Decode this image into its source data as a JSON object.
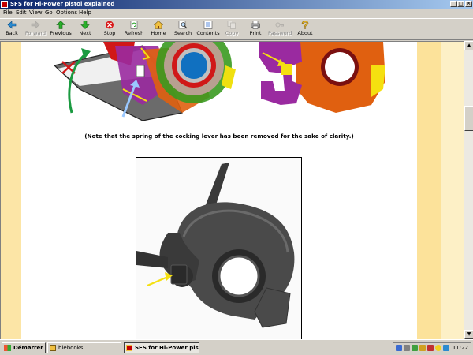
{
  "window": {
    "title": "SFS for Hi-Power pistol explained",
    "controls": {
      "minimize": "_",
      "maximize": "□",
      "close": "×"
    }
  },
  "menu": [
    "File",
    "Edit",
    "View",
    "Go",
    "Options",
    "Help"
  ],
  "toolbar": [
    {
      "label": "Back",
      "icon": "back-arrow-icon",
      "enabled": true
    },
    {
      "label": "Forward",
      "icon": "forward-arrow-icon",
      "enabled": false
    },
    {
      "label": "Previous",
      "icon": "up-arrow-icon",
      "enabled": true
    },
    {
      "label": "Next",
      "icon": "down-arrow-icon",
      "enabled": true
    },
    {
      "label": "Stop",
      "icon": "stop-icon",
      "enabled": true
    },
    {
      "label": "Refresh",
      "icon": "refresh-icon",
      "enabled": true
    },
    {
      "label": "Home",
      "icon": "home-icon",
      "enabled": true
    },
    {
      "label": "Search",
      "icon": "search-icon",
      "enabled": true
    },
    {
      "label": "Contents",
      "icon": "contents-icon",
      "enabled": true
    },
    {
      "label": "Copy",
      "icon": "copy-icon",
      "enabled": false
    },
    {
      "label": "Print",
      "icon": "print-icon",
      "enabled": true
    },
    {
      "label": "Password",
      "icon": "password-icon",
      "enabled": false
    },
    {
      "label": "About",
      "icon": "about-icon",
      "enabled": true
    }
  ],
  "page": {
    "caption": "(Note that the spring of the cocking lever has been removed for the sake of clarity.)"
  },
  "taskbar": {
    "start_label": "Démarrer",
    "tasks": [
      {
        "label": "hlebooks",
        "active": false
      },
      {
        "label": "SFS for Hi-Power pisto...",
        "active": true
      }
    ],
    "clock": "11:22"
  },
  "colors": {
    "title_start": "#0a246a",
    "title_end": "#a6caf0",
    "page_band_left": "#fce5a6",
    "page_band_right": "#fce29a",
    "diagram_orange": "#e05a10",
    "diagram_purple": "#8a1a90",
    "diagram_yellow": "#f5e010",
    "diagram_green": "#3a9a20",
    "diagram_blue": "#1080c0"
  }
}
